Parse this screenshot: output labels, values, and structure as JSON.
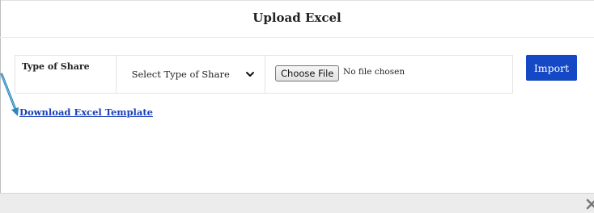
{
  "dialog": {
    "title": "Upload Excel"
  },
  "form": {
    "type_of_share_label": "Type of Share",
    "select": {
      "value": "Select Type of Share"
    },
    "file": {
      "button_label": "Choose File",
      "status": "No file chosen"
    },
    "import_label": "Import"
  },
  "download_link": "Download Excel Template",
  "colors": {
    "accent": "#1448c4",
    "link": "#1a3fb8",
    "footer": "#ececec",
    "annotation_arrow": "#2e86b8"
  },
  "icons": {
    "select": "chevron-down-icon",
    "annotation": "arrow-icon",
    "close": "close-icon"
  }
}
